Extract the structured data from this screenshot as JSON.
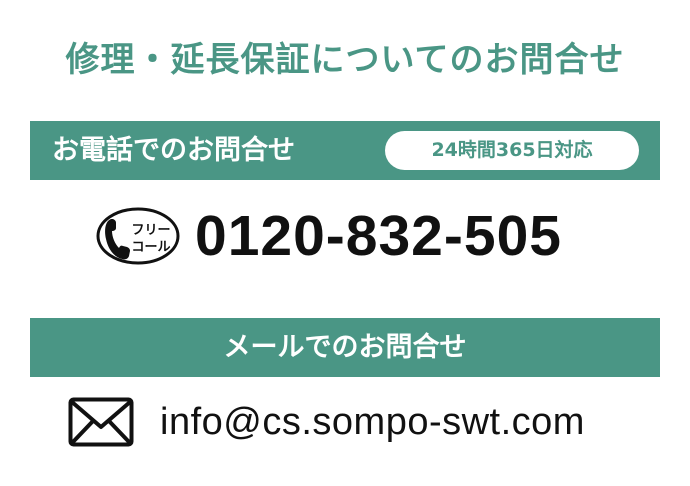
{
  "theme": {
    "accent_color": "#4a9685",
    "text_color": "#111111",
    "background_color": "#ffffff"
  },
  "page": {
    "title": "修理・延長保証についてのお問合せ"
  },
  "phone_section": {
    "heading": "お電話でのお問合せ",
    "hours_badge": "24時間365日対応",
    "freecall_icon": "phone-handset-icon",
    "freecall_line1": "フリー",
    "freecall_line2": "コール",
    "phone_number": "0120-832-505"
  },
  "mail_section": {
    "heading": "メールでのお問合せ",
    "mail_icon": "envelope-icon",
    "email_address": "info@cs.sompo-swt.com"
  }
}
